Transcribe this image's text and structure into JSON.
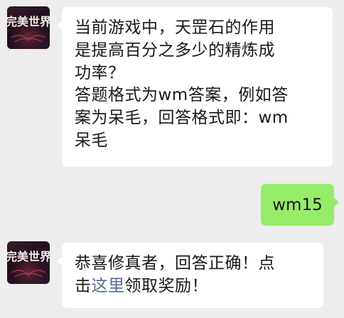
{
  "chat": {
    "messages": [
      {
        "sender": "game-account",
        "avatar_text": "完美世界",
        "lines": [
          "当前游戏中，天罡石的作用",
          "是提高百分之多少的精炼成",
          "功率？",
          "答题格式为wm答案，例如答",
          "案为呆毛，回答格式即：wm",
          "呆毛"
        ]
      },
      {
        "sender": "user",
        "text": "wm15"
      },
      {
        "sender": "game-account",
        "avatar_text": "完美世界",
        "text_before": "恭喜修真者，回答正确！点",
        "text_line2_prefix": "击",
        "link_text": "这里",
        "text_after": "领取奖励！"
      }
    ]
  },
  "colors": {
    "background": "#ededed",
    "incoming_bubble": "#ffffff",
    "outgoing_bubble": "#95ec69",
    "link": "#576b95",
    "text": "#191919"
  }
}
